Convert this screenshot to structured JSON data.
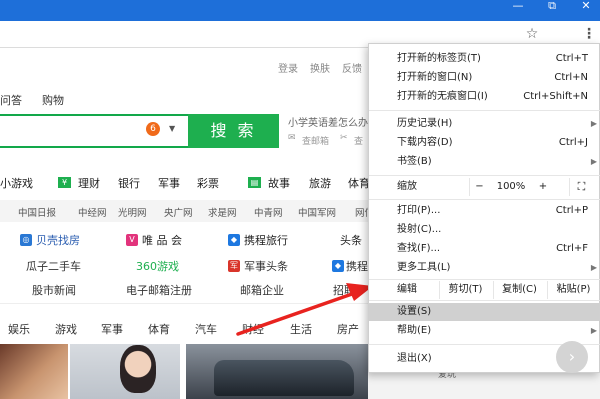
{
  "browser": {
    "controls": {
      "minimize": "—",
      "restore": "⧉",
      "close": "✕"
    },
    "toolbar": {
      "star_icon": "☆",
      "menu_icon": "⋮"
    }
  },
  "page": {
    "top_links": [
      "登录",
      "换肤",
      "反馈"
    ],
    "nav_tabs": [
      "问答",
      "购物"
    ],
    "search": {
      "badge": "6",
      "dropdown": "▼",
      "button": "搜 索"
    },
    "hints": {
      "line1": "小学英语差怎么办",
      "line2a": "查邮箱",
      "line2b": "查"
    },
    "categories": [
      "小游戏",
      "理财",
      "银行",
      "军事",
      "彩票",
      "故事",
      "旅游",
      "体育"
    ],
    "sites": [
      "中国日报",
      "中经网",
      "光明网",
      "央广网",
      "求是网",
      "中青网",
      "中国军网",
      "网信"
    ],
    "services_row1": [
      "贝壳找房",
      "唯 品 会",
      "携程旅行",
      "头条"
    ],
    "services_row2": [
      "瓜子二手车",
      "360游戏",
      "军事头条",
      "携程"
    ],
    "services_row3": [
      "股市新闻",
      "电子邮箱注册",
      "邮箱企业",
      "招聘"
    ],
    "channels": [
      "娱乐",
      "游戏",
      "军事",
      "体育",
      "汽车",
      "财经",
      "生活",
      "房产"
    ],
    "side_snippet": "爱玩"
  },
  "menu": {
    "new_tab": {
      "label": "打开新的标签页(T)",
      "shortcut": "Ctrl+T"
    },
    "new_window": {
      "label": "打开新的窗口(N)",
      "shortcut": "Ctrl+N"
    },
    "incognito": {
      "label": "打开新的无痕窗口(I)",
      "shortcut": "Ctrl+Shift+N"
    },
    "history": {
      "label": "历史记录(H)"
    },
    "downloads": {
      "label": "下载内容(D)",
      "shortcut": "Ctrl+J"
    },
    "bookmarks": {
      "label": "书签(B)"
    },
    "zoom": {
      "label": "缩放",
      "minus": "−",
      "value": "100%",
      "plus": "+",
      "fullscreen": "⛶"
    },
    "print": {
      "label": "打印(P)...",
      "shortcut": "Ctrl+P"
    },
    "cast": {
      "label": "投射(C)..."
    },
    "find": {
      "label": "查找(F)...",
      "shortcut": "Ctrl+F"
    },
    "more_tools": {
      "label": "更多工具(L)"
    },
    "edit": {
      "label": "编辑",
      "cut": "剪切(T)",
      "copy": "复制(C)",
      "paste": "粘贴(P)"
    },
    "settings": {
      "label": "设置(S)"
    },
    "help": {
      "label": "帮助(E)"
    },
    "exit": {
      "label": "退出(X)"
    },
    "submenu_arrow": "▶"
  },
  "colors": {
    "chrome_blue": "#1e6fd9",
    "search_green": "#1eaf4f",
    "arrow_red": "#e8231f",
    "highlight_gray": "#d0d0d0"
  }
}
